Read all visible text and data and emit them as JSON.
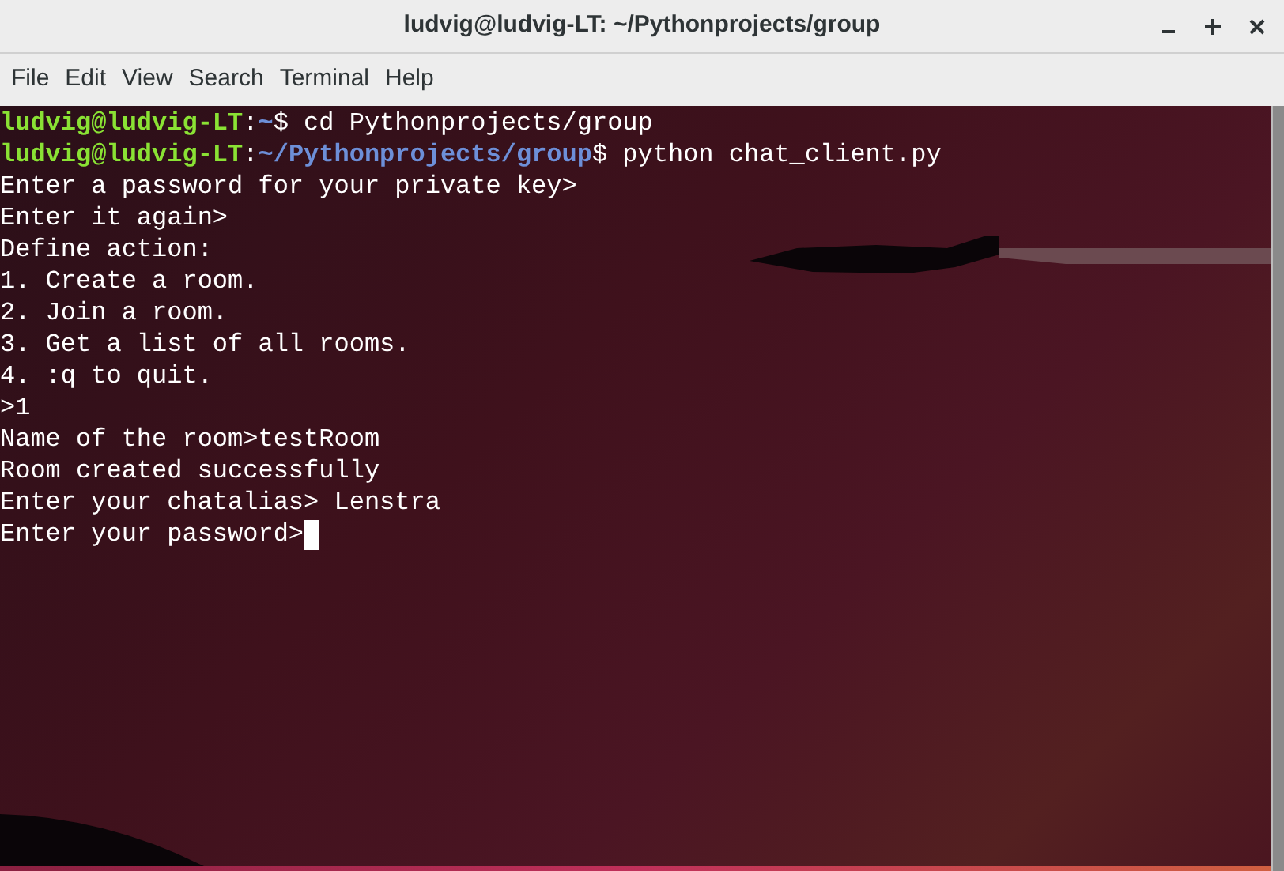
{
  "window": {
    "title": "ludvig@ludvig-LT: ~/Pythonprojects/group"
  },
  "menu": [
    "File",
    "Edit",
    "View",
    "Search",
    "Terminal",
    "Help"
  ],
  "lines": [
    {
      "kind": "prompt",
      "user": "ludvig@ludvig-LT",
      "separator": ":",
      "path": "~",
      "symbol": "$",
      "command": "cd Pythonprojects/group"
    },
    {
      "kind": "prompt",
      "user": "ludvig@ludvig-LT",
      "separator": ":",
      "path": "~/Pythonprojects/group",
      "symbol": "$",
      "command": "python chat_client.py"
    },
    {
      "kind": "output",
      "text": "Enter a password for your private key>"
    },
    {
      "kind": "output",
      "text": "Enter it again>"
    },
    {
      "kind": "output",
      "text": "Define action:"
    },
    {
      "kind": "output",
      "text": "1. Create a room."
    },
    {
      "kind": "output",
      "text": "2. Join a room."
    },
    {
      "kind": "output",
      "text": "3. Get a list of all rooms."
    },
    {
      "kind": "output",
      "text": "4. :q to quit."
    },
    {
      "kind": "output",
      "text": ">1"
    },
    {
      "kind": "output",
      "text": "Name of the room>testRoom"
    },
    {
      "kind": "output",
      "text": "Room created successfully"
    },
    {
      "kind": "output",
      "text": "Enter your chatalias> Lenstra"
    },
    {
      "kind": "output",
      "text": "Enter your password>",
      "cursor": true
    }
  ]
}
